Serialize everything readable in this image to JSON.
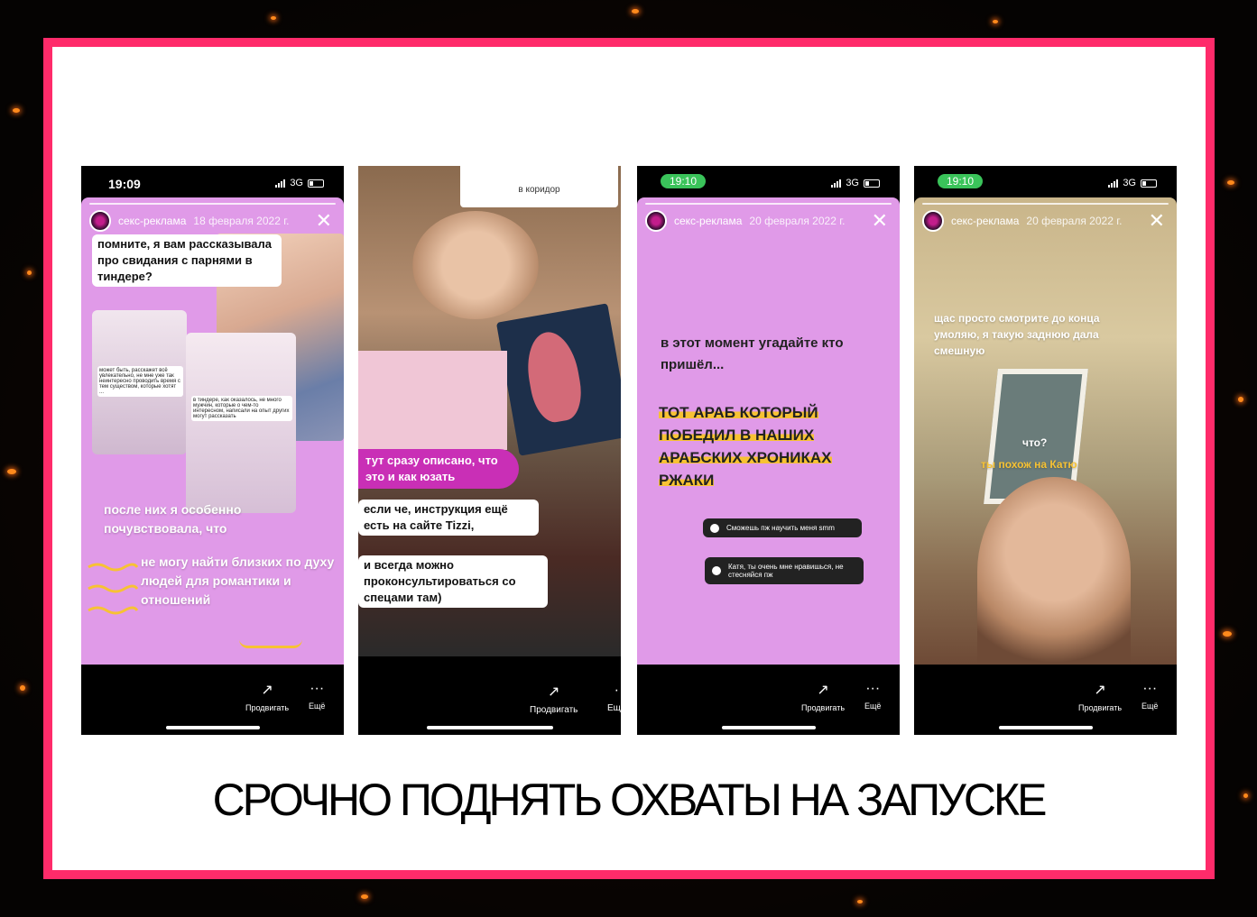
{
  "headline": "СРОЧНО ПОДНЯТЬ ОХВАТЫ НА ЗАПУСКЕ",
  "colors": {
    "frame": "#ff2b6a",
    "story_bg": "#e09ae8",
    "highlight": "#f7c233",
    "time_pill": "#3ac35a"
  },
  "common": {
    "network": "3G",
    "promote_label": "Продвигать",
    "more_label": "Ещё"
  },
  "phones": [
    {
      "time": "19:09",
      "account": "секс-реклама",
      "date": "18 февраля 2022 г.",
      "top_text": "помните, я вам  рассказывала про свидания с парнями в тиндере?",
      "mid_text": "после них я особенно почувствовала, что",
      "highlight_text": "не могу найти близких по духу людей для романтики и отношений",
      "mini_note_1": "может быть, расскажет всё увлекательно, не мне уже так неинтересно проводить время с тем существом, которые хотят ...",
      "mini_note_2": "в тиндере, как оказалось, не много мужчин, которые о чем-то интересном, написали на опыт других могут рассказать"
    },
    {
      "top_label": "в коридор",
      "caption_1": "тут сразу описано, что это и как юзать",
      "caption_2": "если че, инструкция ещё есть на сайте Tizzi,",
      "caption_3": "и всегда можно проконсультироваться со спецами там)"
    },
    {
      "time": "19:10",
      "account": "секс-реклама",
      "date": "20 февраля 2022 г.",
      "text_1": "в этот момент угадайте кто пришёл...",
      "text_2": "ТОТ АРАБ КОТОРЫЙ ПОБЕДИЛ В НАШИХ АРАБСКИХ ХРОНИКАХ РЖАКИ",
      "poll_1": "Сможешь пж научить меня smm",
      "poll_2": "Катя, ты очень мне нравишься, не стесняйся пж"
    },
    {
      "time": "19:10",
      "account": "секс-реклама",
      "date": "20 февраля 2022 г.",
      "text_1": "щас просто смотрите до конца умоляю, я такую заднюю дала смешную",
      "text_2": "что?",
      "text_3": "ты похож на Катю"
    }
  ]
}
